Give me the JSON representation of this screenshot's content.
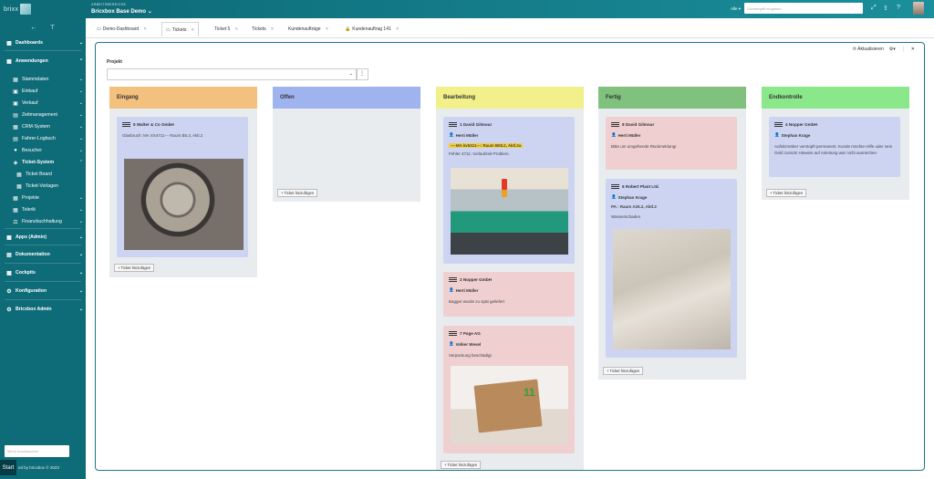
{
  "app": {
    "logo_text": "brixx"
  },
  "sidebar": {
    "items": [
      {
        "label": "Dashboards"
      },
      {
        "label": "Anwendungen"
      },
      {
        "label": "Stammdaten"
      },
      {
        "label": "Einkauf"
      },
      {
        "label": "Verkauf"
      },
      {
        "label": "Zeitmanagement"
      },
      {
        "label": "CRM-System"
      },
      {
        "label": "Fahrer-Logbuch"
      },
      {
        "label": "Besucher"
      },
      {
        "label": "Ticket-System"
      },
      {
        "label": "Ticket Board"
      },
      {
        "label": "Ticket-Vorlagen"
      },
      {
        "label": "Projekte"
      },
      {
        "label": "Telerik"
      },
      {
        "label": "Finanzbuchhaltung"
      },
      {
        "label": "Apps (Admin)"
      },
      {
        "label": "Dokumentation"
      },
      {
        "label": "Cockpits"
      },
      {
        "label": "Konfiguration"
      },
      {
        "label": "Bricxbox Admin"
      }
    ],
    "search_placeholder": "Menü durchsuchen",
    "footer": "ed by bricxbox © 2023",
    "start": "Start"
  },
  "topbar": {
    "workspace_label": "ARBEITSBEREICHE",
    "workspace_title": "Bricxbox Base Demo",
    "filter_label": "Alle",
    "search_placeholder": "Suchbegriff eingeben"
  },
  "tabs": [
    {
      "label": "Demo-Dashboard"
    },
    {
      "label": "Tickets"
    },
    {
      "label": "Ticket 5"
    },
    {
      "label": "Tickets"
    },
    {
      "label": "Kundenaufträge"
    },
    {
      "label": "Kundenauftrag 141"
    }
  ],
  "panel": {
    "refresh_label": "Aktualisieren",
    "project_label": "Projekt",
    "add_ticket_label": "+ Ticket hinzufügen"
  },
  "columns": [
    {
      "title": "Eingang",
      "color": "#f3c07d"
    },
    {
      "title": "Offen",
      "color": "#9fb3ef"
    },
    {
      "title": "Bearbeitung",
      "color": "#f1f08a"
    },
    {
      "title": "Fertig",
      "color": "#80c17e"
    },
    {
      "title": "Endkontrolle",
      "color": "#8ae88a"
    }
  ],
  "cards": {
    "c1": {
      "title": "5 Walter & Co GmbH",
      "text": "Glasbruch: MA XX4711--- Raum B5.3, Aktl.2"
    },
    "c2": {
      "title": "1 David Gilmour",
      "user": "Herti Müller",
      "highlight": "----MA bv5311---: Raum B08.2, Aktl.2a",
      "text": "Fehler 4711: Vorlaufzeit-Problem."
    },
    "c3": {
      "title": "2 Nopper GmbH",
      "user": "Herti Müller",
      "text": "Bagger wurde zu spät geliefert"
    },
    "c4": {
      "title": "7 Page AG",
      "user": "Volker Wesel",
      "text": "Verpackung beschädigt"
    },
    "c5": {
      "title": "8 David Gilmour",
      "user": "Herti Müller",
      "text": "Bitte um umgehende Rückmeldung!"
    },
    "c6": {
      "title": "6 Robert Plant Ltd.",
      "user": "Stephan Krage",
      "highlight": "PA : Raum A25.2, Aktl.2",
      "text": "Wasserschaden"
    },
    "c7": {
      "title": "4 Nopper GmbH",
      "user": "Stephan Krage",
      "text": "Aufsitzmäher verstopft permanent. Kunde möchte Hilfe oder sein Geld zurück! Hinweis auf Anleitung war nicht ausreichen"
    }
  },
  "colors": {
    "sidebar": "#0e6b78",
    "accent": "#1c7a87",
    "card_blue": "#cdd4f2",
    "card_red": "#efcfd0"
  }
}
